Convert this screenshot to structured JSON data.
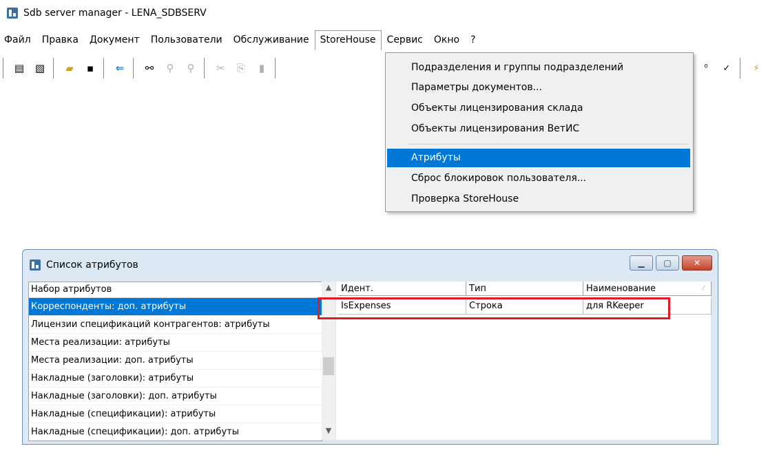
{
  "window": {
    "title": "Sdb server manager - LENA_SDBSERV"
  },
  "menubar": {
    "items": [
      "Файл",
      "Правка",
      "Документ",
      "Пользователи",
      "Обслуживание",
      "StoreHouse",
      "Сервис",
      "Окно",
      "?"
    ]
  },
  "toolbar": {
    "icons": [
      "list-icon",
      "list-settings-icon",
      "open-folder-icon",
      "save-icon",
      "back-arrow-icon",
      "binoculars-icon",
      "find-icon",
      "find-next-icon",
      "cut-icon",
      "copy-icon",
      "paste-icon",
      "tool-a-icon",
      "tool-b-icon",
      "tool-c-icon"
    ]
  },
  "dropdown": {
    "items": [
      "Подразделения и группы подразделений",
      "Параметры документов...",
      "Объекты лицензирования склада",
      "Объекты лицензирования ВетИС",
      "Атрибуты",
      "Сброс блокировок пользователя...",
      "Проверка StoreHouse"
    ],
    "selected": "Атрибуты"
  },
  "child_window": {
    "title": "Список атрибутов",
    "left_pane": {
      "header": "Набор атрибутов",
      "rows": [
        "Корреспонденты: доп. атрибуты",
        "Лицензии спецификаций контрагентов: атрибуты",
        "Места реализации: атрибуты",
        "Места реализации: доп. атрибуты",
        "Накладные (заголовки): атрибуты",
        "Накладные (заголовки): доп. атрибуты",
        "Накладные (спецификации): атрибуты",
        "Накладные (спецификации): доп. атрибуты"
      ],
      "selected_index": 0
    },
    "grid": {
      "columns": [
        "Идент.",
        "Тип",
        "Наименование"
      ],
      "rows": [
        [
          "IsExpenses",
          "Строка",
          "для RKeeper"
        ]
      ]
    }
  },
  "colors": {
    "selection": "#0078d7",
    "highlight_border": "#e01b24"
  }
}
